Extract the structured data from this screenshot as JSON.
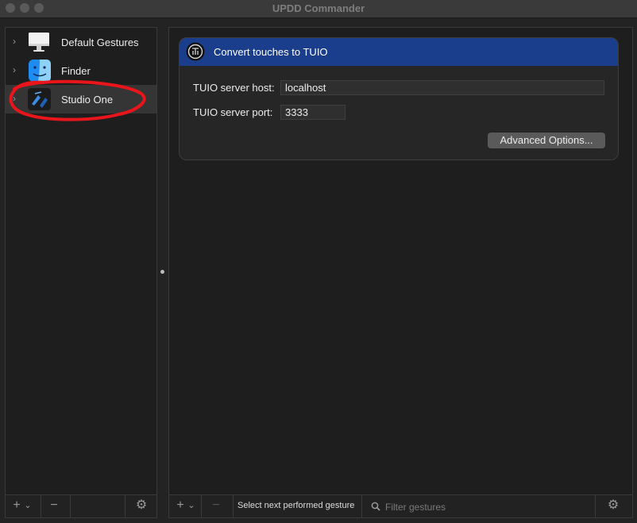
{
  "window": {
    "title": "UPDD Commander"
  },
  "sidebar": {
    "items": [
      {
        "label": "Default Gestures",
        "icon": "monitor-icon",
        "selected": false
      },
      {
        "label": "Finder",
        "icon": "finder-icon",
        "selected": false
      },
      {
        "label": "Studio One",
        "icon": "studio-one-icon",
        "selected": true
      }
    ],
    "bottombar": {
      "add": "+",
      "add_menu": "⌄",
      "remove": "−",
      "settings": "⚙"
    }
  },
  "main": {
    "card": {
      "title": "Convert touches to TUIO",
      "badge_icon": "tuio-icon",
      "host_label": "TUIO server host:",
      "host_value": "localhost",
      "port_label": "TUIO server port:",
      "port_value": "3333",
      "advanced_label": "Advanced Options..."
    },
    "bottombar": {
      "add": "+",
      "add_menu": "⌄",
      "remove": "−",
      "select_gesture": "Select next performed gesture",
      "filter_placeholder": "Filter gestures",
      "settings": "⚙"
    }
  },
  "annotation": {
    "color": "#e8151b"
  }
}
